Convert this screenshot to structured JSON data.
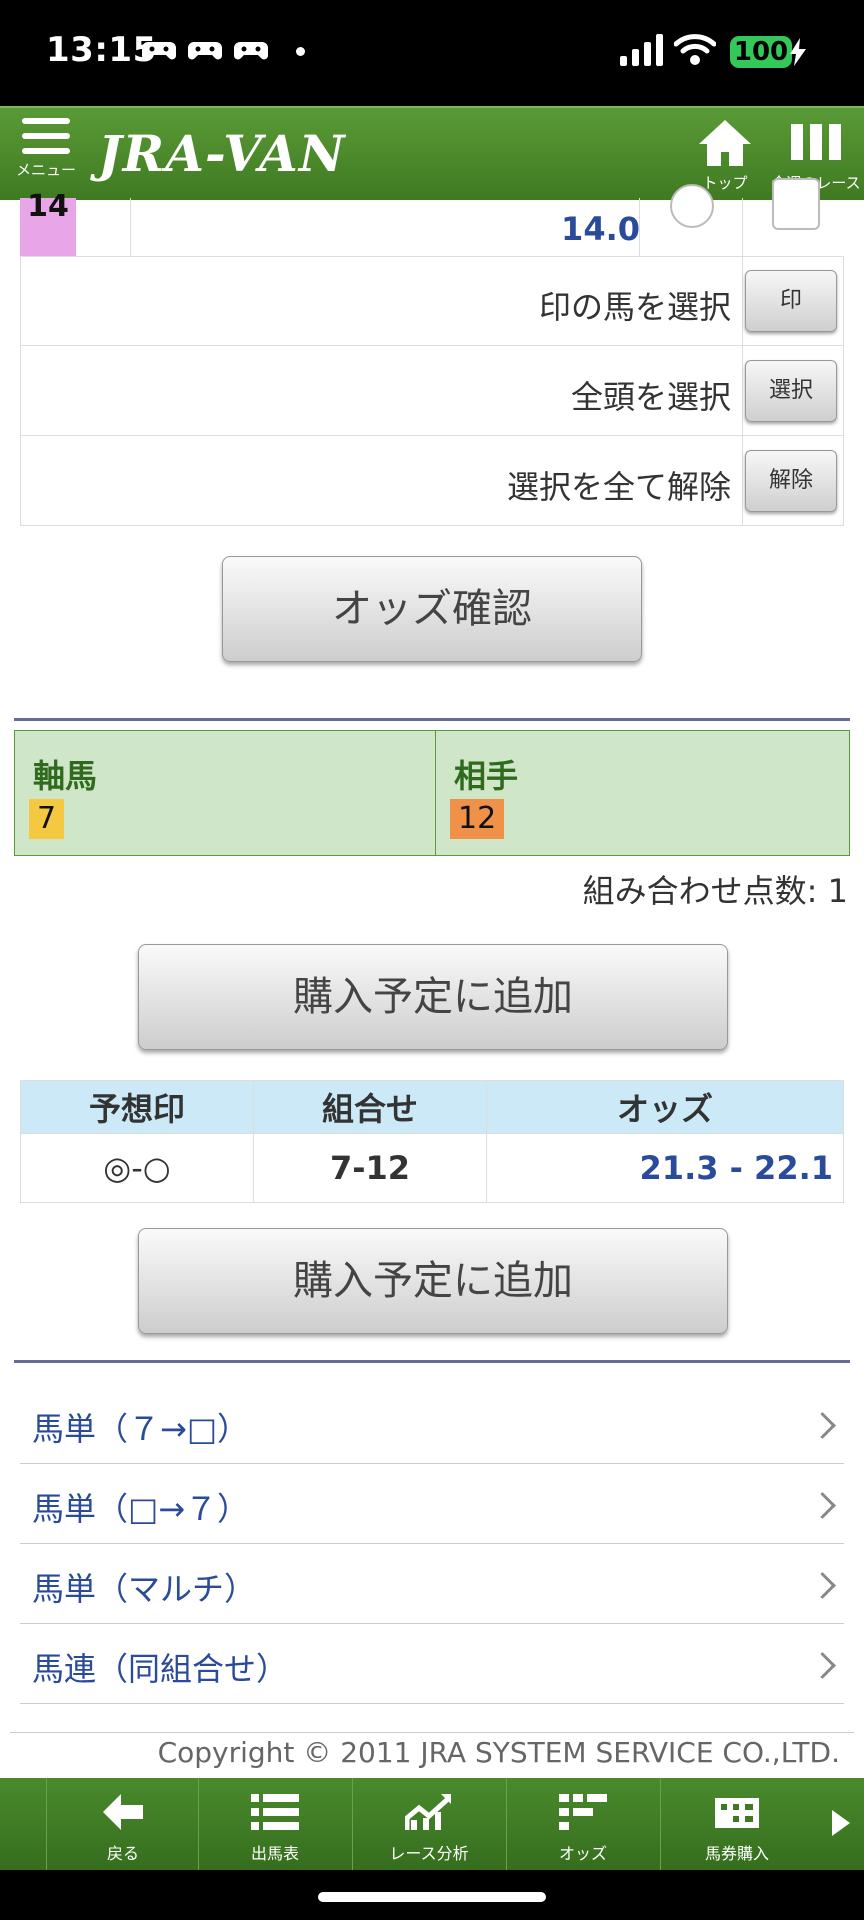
{
  "status_bar": {
    "time": "13:15",
    "battery": "100"
  },
  "header": {
    "menu_label": "メニュー",
    "logo": "JRA-VAN",
    "top_label": "トップ",
    "week_label": "今週のレース"
  },
  "horse_row": {
    "number": "14",
    "odds": "14.0"
  },
  "selection": {
    "mark_label": "印の馬を選択",
    "mark_btn": "印",
    "all_label": "全頭を選択",
    "all_btn": "選択",
    "clear_label": "選択を全て解除",
    "clear_btn": "解除"
  },
  "odds_button": "オッズ確認",
  "combo": {
    "axis_head": "軸馬",
    "axis_value": "7",
    "partner_head": "相手",
    "partner_value": "12"
  },
  "count_text": "組み合わせ点数: 1",
  "add_button": "購入予定に追加",
  "table": {
    "headers": [
      "予想印",
      "組合せ",
      "オッズ"
    ],
    "rows": [
      {
        "mark": "◎-○",
        "combo": "7-12",
        "odds": "21.3 - 22.1"
      }
    ]
  },
  "links": [
    "馬単（７→□）",
    "馬単（□→７）",
    "馬単（マルチ）",
    "馬連（同組合せ）"
  ],
  "copyright": "Copyright © 2011 JRA SYSTEM SERVICE CO.,LTD.",
  "bottom_nav": [
    "戻る",
    "出馬表",
    "レース分析",
    "オッズ",
    "馬券購入"
  ],
  "colors": {
    "header_green": "#4a8a2c",
    "link_blue": "#2a4a9a",
    "combo_bg": "#cfe6c9",
    "table_head": "#cce9f7"
  }
}
